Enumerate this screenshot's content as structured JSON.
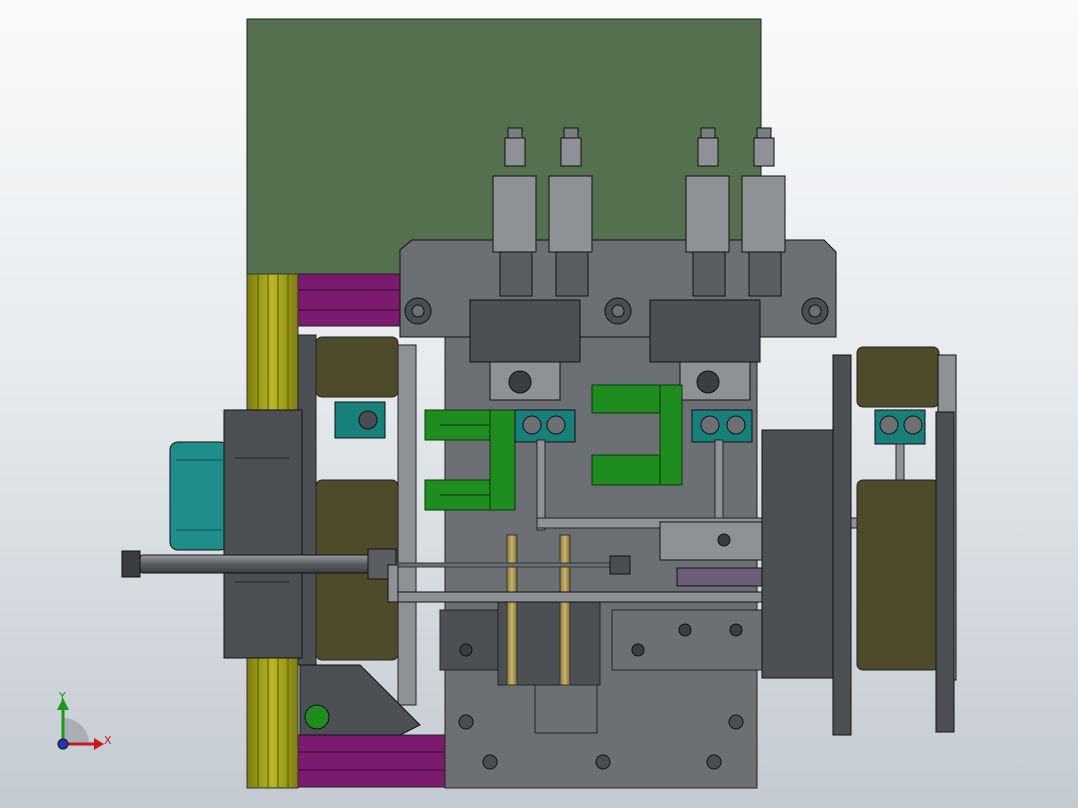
{
  "viewport": {
    "background_top": "#f9fafb",
    "background_bottom": "#c3cad1"
  },
  "colors": {
    "olive_panel": "#54704f",
    "yellow_rail": "#a4a317",
    "magenta_block": "#7b1a6e",
    "teal_motor": "#1f8d8a",
    "green_clamp": "#1f8c1f",
    "dark_roller": "#4e4b2b",
    "steel_gray": "#6c7075",
    "dark_steel": "#4c5055",
    "light_steel": "#8e9297",
    "slider_purple": "#6a5d78",
    "cyan_block": "#17807a"
  },
  "triad": {
    "x_label": "X",
    "y_label": "Y",
    "x_color": "#cc1818",
    "y_color": "#1a9a1a",
    "origin_color": "#2233bb"
  }
}
